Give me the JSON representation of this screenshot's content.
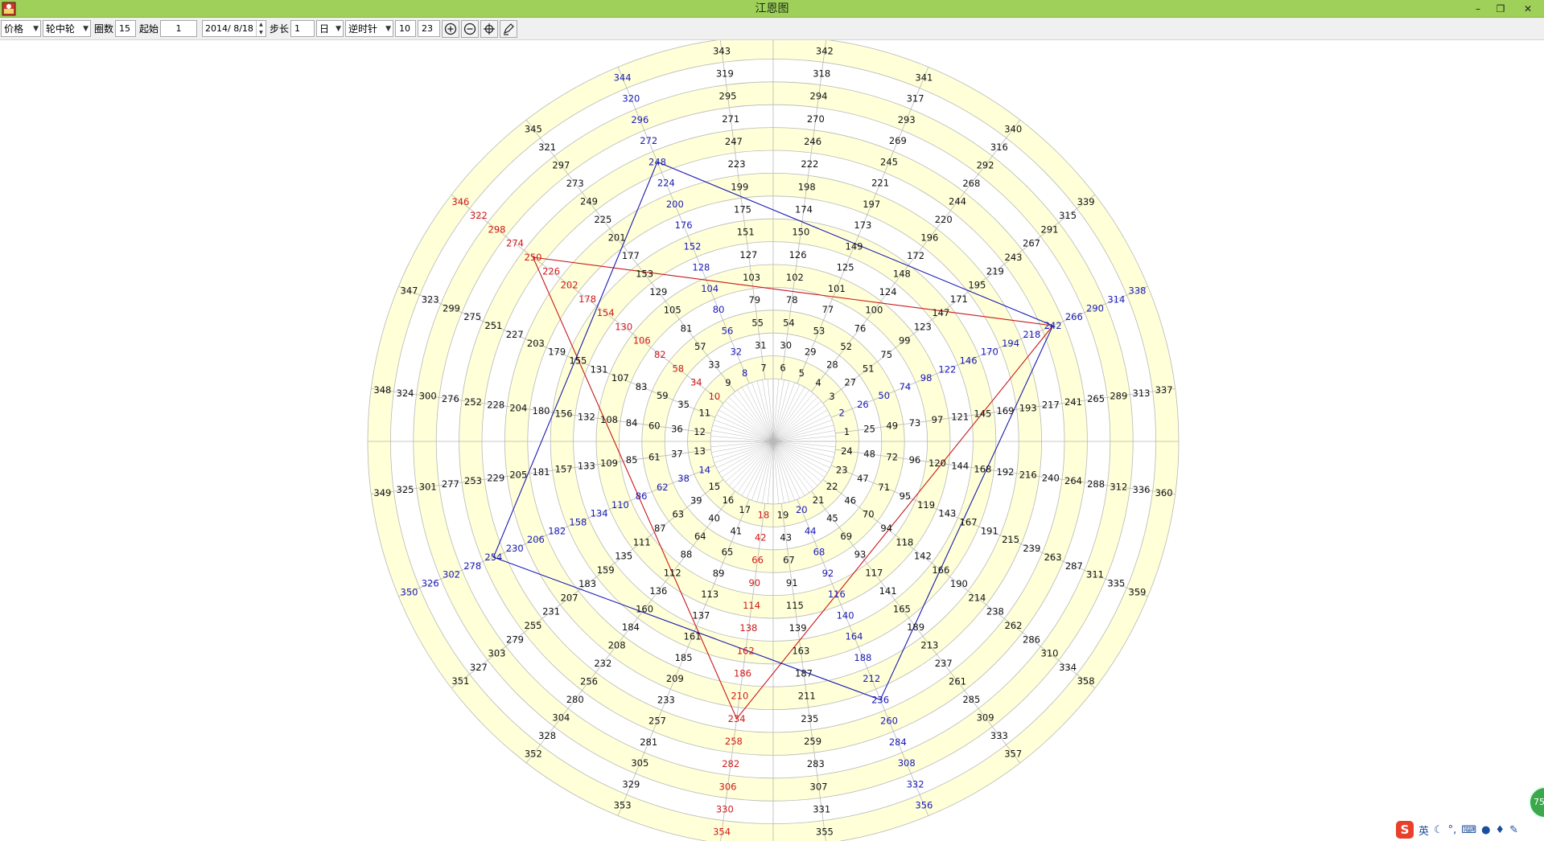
{
  "window": {
    "title": "江恩图",
    "minimize_glyph": "–",
    "restore_glyph": "❐",
    "close_glyph": "✕"
  },
  "toolbar": {
    "price_select": "价格",
    "mode_select": "轮中轮",
    "rings_label": "圈数",
    "rings_value": "15",
    "start_label": "起始",
    "start_value": "1",
    "date_value": "2014/ 8/18",
    "step_label": "步长",
    "step_value": "1",
    "unit_select": "日",
    "direction_select": "逆时针",
    "value_a": "10",
    "value_b": "23"
  },
  "icons": {
    "zoom_in": "zoom-in-icon",
    "zoom_out": "zoom-out-icon",
    "center": "crosshair-icon",
    "draw": "pen-icon"
  },
  "wheel": {
    "rings": 15,
    "sectors": 24,
    "start": 1,
    "direction": "counterclockwise",
    "colors": {
      "ring_fill_alt": "#ffffd8",
      "ring_fill": "#ffffff",
      "grid": "#b8b8b8",
      "text_default": "#111111",
      "text_blue": "#1a1ab8",
      "text_red": "#d01818",
      "shape_blue": "#1a1ab0",
      "shape_red": "#c81818"
    },
    "blue_numbers": [
      2,
      8,
      14,
      20,
      26,
      32,
      38,
      44,
      50,
      56,
      62,
      68,
      74,
      80,
      86,
      92,
      98,
      104,
      110,
      116,
      122,
      128,
      134,
      140,
      146,
      152,
      158,
      164,
      170,
      176,
      182,
      188,
      194,
      200,
      206,
      212,
      218,
      224,
      230,
      236,
      242,
      248,
      254,
      260,
      266,
      272,
      278,
      284,
      290,
      296,
      302,
      308,
      314,
      320,
      326,
      332,
      338,
      344,
      350,
      356
    ],
    "red_numbers": [
      10,
      18,
      34,
      42,
      58,
      66,
      82,
      90,
      106,
      114,
      130,
      138,
      154,
      162,
      178,
      186,
      202,
      210,
      226,
      234,
      250,
      258,
      274,
      282,
      298,
      306,
      322,
      330,
      346,
      354
    ],
    "triangle": [
      250,
      242,
      234
    ],
    "square": [
      248,
      242,
      236,
      254
    ]
  },
  "tray": {
    "ime_glyph": "S",
    "ime_lang": "英",
    "orb_text": "75"
  }
}
